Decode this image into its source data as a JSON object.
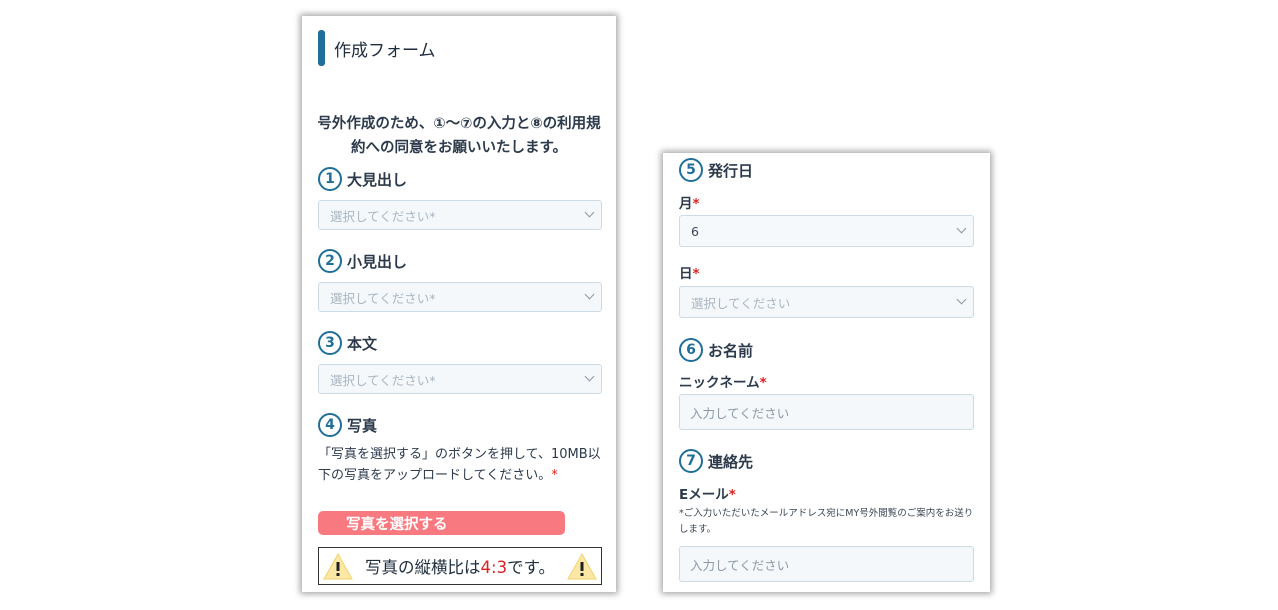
{
  "left": {
    "title": "作成フォーム",
    "intro": "号外作成のため、①〜⑦の入力と⑧の利用規約への同意をお願いいたします。",
    "sections": [
      {
        "num": "1",
        "label": "大見出し",
        "placeholder": "選択してください*"
      },
      {
        "num": "2",
        "label": "小見出し",
        "placeholder": "選択してください*"
      },
      {
        "num": "3",
        "label": "本文",
        "placeholder": "選択してください*"
      }
    ],
    "photo": {
      "num": "4",
      "label": "写真",
      "desc": "「写真を選択する」のボタンを押して、10MB以下の写真をアップロードしてください。",
      "required_mark": "*",
      "button_label": "写真を選択する",
      "notice_prefix": "写真の縦横比は",
      "notice_ratio": "4:3",
      "notice_suffix": "です。",
      "warning_icon": "warning-icon"
    }
  },
  "right": {
    "issue_date": {
      "num": "5",
      "label": "発行日",
      "month_label": "月",
      "month_value": "6",
      "day_label": "日",
      "day_placeholder": "選択してください"
    },
    "name": {
      "num": "6",
      "label": "お名前",
      "nickname_label": "ニックネーム",
      "nickname_placeholder": "入力してください"
    },
    "contact": {
      "num": "7",
      "label": "連絡先",
      "email_label": "Eメール",
      "email_note": "*ご入力いただいたメールアドレス宛にMY号外閲覧のご案内をお送りします。",
      "email_placeholder": "入力してください"
    },
    "required_mark": "*"
  },
  "colors": {
    "accent": "#1f6f9a",
    "button": "#f8797f",
    "required": "#e02020"
  }
}
